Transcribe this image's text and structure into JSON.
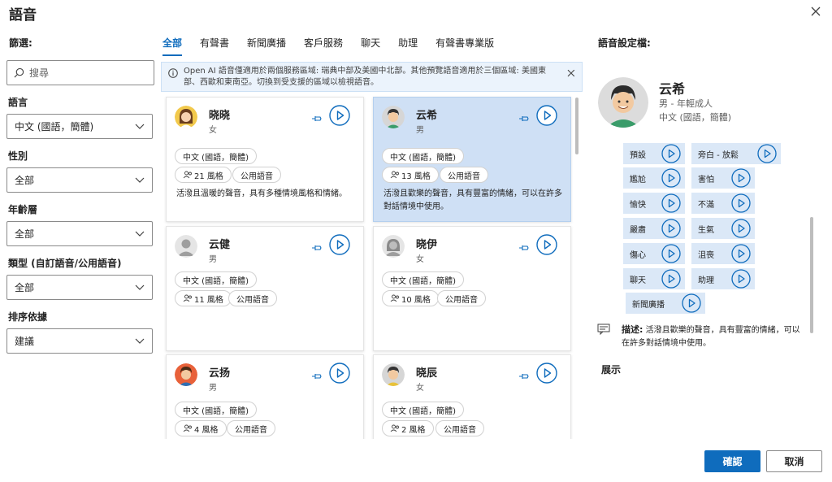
{
  "dialog": {
    "title": "語音",
    "close_icon": "close-icon"
  },
  "filters": {
    "heading": "篩選:",
    "search_placeholder": "搜尋",
    "language": {
      "label": "語言",
      "value": "中文 (國語，簡體)"
    },
    "gender": {
      "label": "性別",
      "value": "全部"
    },
    "age": {
      "label": "年齡層",
      "value": "全部"
    },
    "type": {
      "label": "類型 (自訂語音/公用語音)",
      "value": "全部"
    },
    "sort": {
      "label": "排序依據",
      "value": "建議"
    }
  },
  "tabs": [
    {
      "label": "全部",
      "active": true
    },
    {
      "label": "有聲書"
    },
    {
      "label": "新聞廣播"
    },
    {
      "label": "客戶服務"
    },
    {
      "label": "聊天"
    },
    {
      "label": "助理"
    },
    {
      "label": "有聲書專業版"
    }
  ],
  "info_bar": {
    "text": "Open AI 語音僅適用於兩個服務區域: 瑞典中部及美國中北部。其他預覽語音適用於三個區域: 美國東部、西歐和東南亞。切換到受支援的區域以檢視語音。"
  },
  "voices": [
    {
      "name": "晓晓",
      "gender": "女",
      "locale": "中文 (國語，簡體)",
      "styles": "21 風格",
      "type": "公用語音",
      "desc": "活潑且溫暖的聲音，具有多種情境風格和情緒。"
    },
    {
      "name": "云希",
      "gender": "男",
      "locale": "中文 (國語，簡體)",
      "styles": "13 風格",
      "type": "公用語音",
      "desc": "活潑且歡樂的聲音，具有豐富的情緒，可以在許多對話情境中使用。"
    },
    {
      "name": "云健",
      "gender": "男",
      "locale": "中文 (國語，簡體)",
      "styles": "11 風格",
      "type": "公用語音",
      "desc": ""
    },
    {
      "name": "晓伊",
      "gender": "女",
      "locale": "中文 (國語，簡體)",
      "styles": "10 風格",
      "type": "公用語音",
      "desc": ""
    },
    {
      "name": "云扬",
      "gender": "男",
      "locale": "中文 (國語，簡體)",
      "styles": "4 風格",
      "type": "公用語音",
      "desc": ""
    },
    {
      "name": "晓辰",
      "gender": "女",
      "locale": "中文 (國語，簡體)",
      "styles": "2 風格",
      "type": "公用語音",
      "desc": ""
    }
  ],
  "profile": {
    "heading": "語音設定檔:",
    "name": "云希",
    "sub1": "男 - 年輕成人",
    "sub2": "中文 (國語，簡體)",
    "styles": [
      "預設",
      "旁白 - 放鬆",
      "尷尬",
      "害怕",
      "愉快",
      "不滿",
      "嚴肅",
      "生氣",
      "傷心",
      "沮喪",
      "聊天",
      "助理",
      "新聞廣播"
    ],
    "desc_label": "描述:",
    "desc_text": "活潑且歡樂的聲音，具有豐富的情緒，可以在許多對話情境中使用。",
    "demo_label": "展示"
  },
  "footer": {
    "ok": "確認",
    "cancel": "取消"
  },
  "colors": {
    "accent": "#0f6cbd",
    "selected_card": "#cfe0f5",
    "style_button": "#dbe8f7",
    "info_bg": "#ebf3fc"
  }
}
